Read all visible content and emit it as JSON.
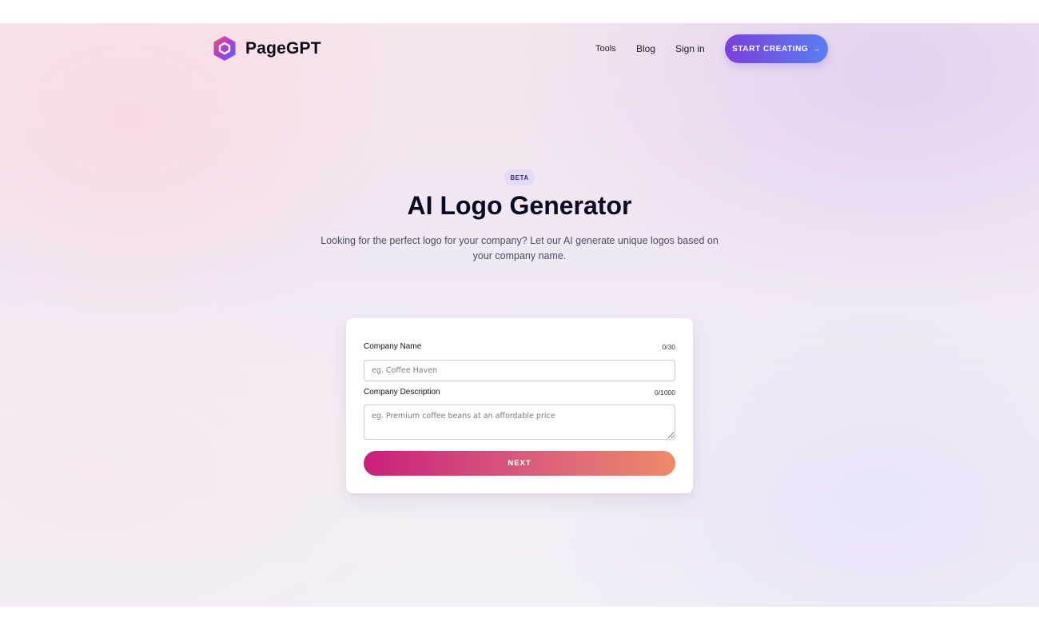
{
  "nav": {
    "brand": "PageGPT",
    "links": {
      "tools": "Tools",
      "blog": "Blog",
      "signin": "Sign in"
    },
    "cta_label": "START CREATING",
    "cta_arrow": "→"
  },
  "hero": {
    "badge": "BETA",
    "title": "AI Logo Generator",
    "subtitle": "Looking for the perfect logo for your company? Let our AI generate unique logos based on your company name."
  },
  "form": {
    "name_label": "Company Name",
    "name_count": "0/30",
    "name_placeholder": "eg. Coffee Haven",
    "desc_label": "Company Description",
    "desc_count": "0/1000",
    "desc_placeholder": "eg. Premium coffee beans at an affordable price",
    "next_label": "NEXT"
  },
  "colors": {
    "cta_start": "#7a3fdc",
    "cta_end": "#5a7ef0",
    "next_start": "#c8207a",
    "next_end": "#ef8a6a",
    "badge_bg": "#e4dcf7"
  },
  "icons": {
    "brand": "hexagon-logo-icon",
    "cta": "arrow-right-icon"
  }
}
